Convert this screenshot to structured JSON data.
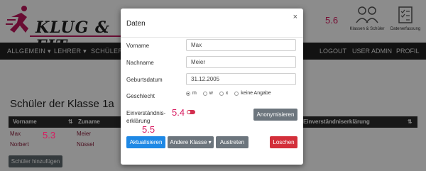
{
  "header": {
    "logo_text": "KLUG & FIT",
    "icons": [
      {
        "name": "klassen-schueler-icon",
        "label": "Klassen & Schüler"
      },
      {
        "name": "datenerfassung-icon",
        "label": "Datenerfassung"
      }
    ]
  },
  "nav": {
    "left": [
      "ALLGEMEIN ▾",
      "LEHRER ▾",
      "SCHÜLER ▾"
    ],
    "right": [
      "LOGOUT",
      "USER ADMIN",
      "PROFIL"
    ]
  },
  "main": {
    "title": "Schüler der Klasse 1a",
    "columns": [
      "Vorname",
      "Zuname",
      "Einverständniserklärung"
    ],
    "rows": [
      {
        "vorname": "Max",
        "zuname": "Meier"
      },
      {
        "vorname": "Norbert",
        "zuname": "Nüssel"
      }
    ],
    "add_button": "Schüler hinzufügen"
  },
  "annotations": {
    "a53": "5.3",
    "a54": "5.4",
    "a55": "5.5",
    "a56": "5.6"
  },
  "modal": {
    "title": "Daten",
    "close": "×",
    "fields": {
      "vorname_label": "Vorname",
      "vorname_value": "Max",
      "nachname_label": "Nachname",
      "nachname_value": "Meier",
      "geburtsdatum_label": "Geburtsdatum",
      "geburtsdatum_value": "31.12.2005",
      "geschlecht_label": "Geschlecht",
      "geschlecht_options": [
        "m",
        "w",
        "x",
        "keine Angabe"
      ],
      "geschlecht_selected": "m",
      "einverstaendnis_label_1": "Einverständnis-",
      "einverstaendnis_label_2": "erklärung"
    },
    "buttons": {
      "anonymisieren": "Anonymisieren",
      "aktualisieren": "Aktualisieren",
      "andere_klasse": "Andere Klasse ▾",
      "austreten": "Austreten",
      "loeschen": "Loschen"
    }
  },
  "colors": {
    "brand": "#c0185d",
    "primary": "#1e88e5",
    "danger": "#d32f3a",
    "navbar": "#222222"
  }
}
